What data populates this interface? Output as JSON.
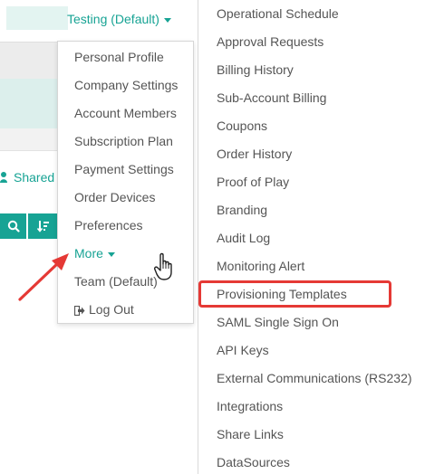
{
  "header": {
    "account_label": "Testing (Default)"
  },
  "left_panel": {
    "shared_tab_label": "Shared"
  },
  "account_menu": {
    "items": [
      {
        "label": "Personal Profile"
      },
      {
        "label": "Company Settings"
      },
      {
        "label": "Account Members"
      },
      {
        "label": "Subscription Plan"
      },
      {
        "label": "Payment Settings"
      },
      {
        "label": "Order Devices"
      },
      {
        "label": "Preferences"
      },
      {
        "label": "More",
        "active": true
      },
      {
        "label": "Team (Default)"
      },
      {
        "label": "Log Out"
      }
    ]
  },
  "more_submenu": {
    "items": [
      {
        "label": "Operational Schedule"
      },
      {
        "label": "Approval Requests"
      },
      {
        "label": "Billing History"
      },
      {
        "label": "Sub-Account Billing"
      },
      {
        "label": "Coupons"
      },
      {
        "label": "Order History"
      },
      {
        "label": "Proof of Play"
      },
      {
        "label": "Branding"
      },
      {
        "label": "Audit Log"
      },
      {
        "label": "Monitoring Alert"
      },
      {
        "label": "Provisioning Templates",
        "highlighted": true
      },
      {
        "label": "SAML Single Sign On"
      },
      {
        "label": "API Keys"
      },
      {
        "label": "External Communications (RS232)"
      },
      {
        "label": "Integrations"
      },
      {
        "label": "Share Links"
      },
      {
        "label": "DataSources"
      }
    ]
  },
  "colors": {
    "accent": "#17a394",
    "highlight": "#e53935",
    "text": "#555555"
  },
  "icons": {
    "search": "search-icon",
    "sort": "sort-icon",
    "shared": "users-icon",
    "logout": "sign-out-icon",
    "caret": "caret-down-icon",
    "pointer": "hand-pointer-icon",
    "annotation": "red-arrow"
  }
}
